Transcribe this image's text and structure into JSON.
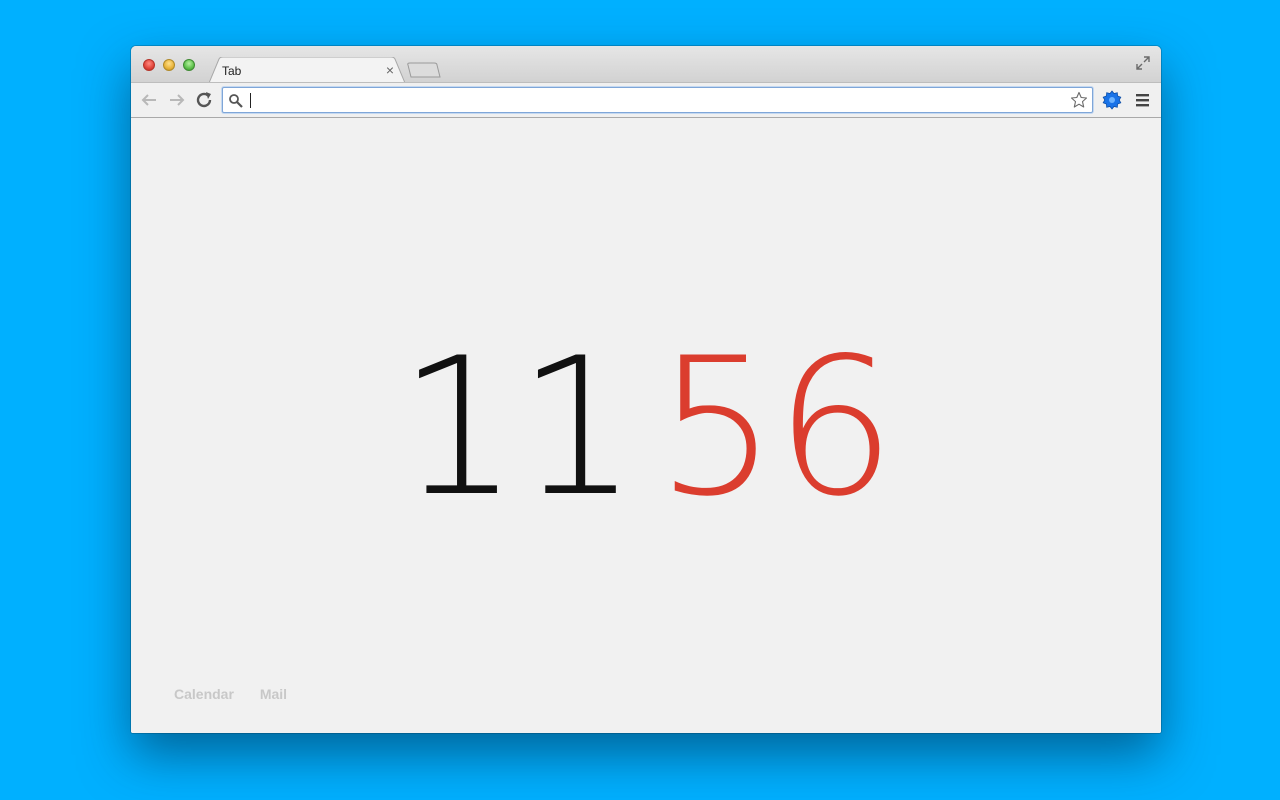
{
  "browser": {
    "tab_title": "Tab",
    "tab_close_glyph": "×",
    "omnibox_value": "",
    "icons": {
      "search": "search-icon",
      "star": "star-icon",
      "extension": "extension-icon",
      "menu": "menu-icon",
      "back": "back-arrow-icon",
      "forward": "forward-arrow-icon",
      "reload": "reload-icon",
      "fullscreen": "fullscreen-icon"
    }
  },
  "clock": {
    "hours": "11",
    "minutes": "56",
    "hours_color": "#111111",
    "minutes_color": "#db3d2e"
  },
  "links": [
    {
      "label": "Calendar"
    },
    {
      "label": "Mail"
    }
  ],
  "colors": {
    "desktop": "#00b0ff",
    "page_background": "#f1f1f1",
    "accent": "#db3d2e"
  }
}
